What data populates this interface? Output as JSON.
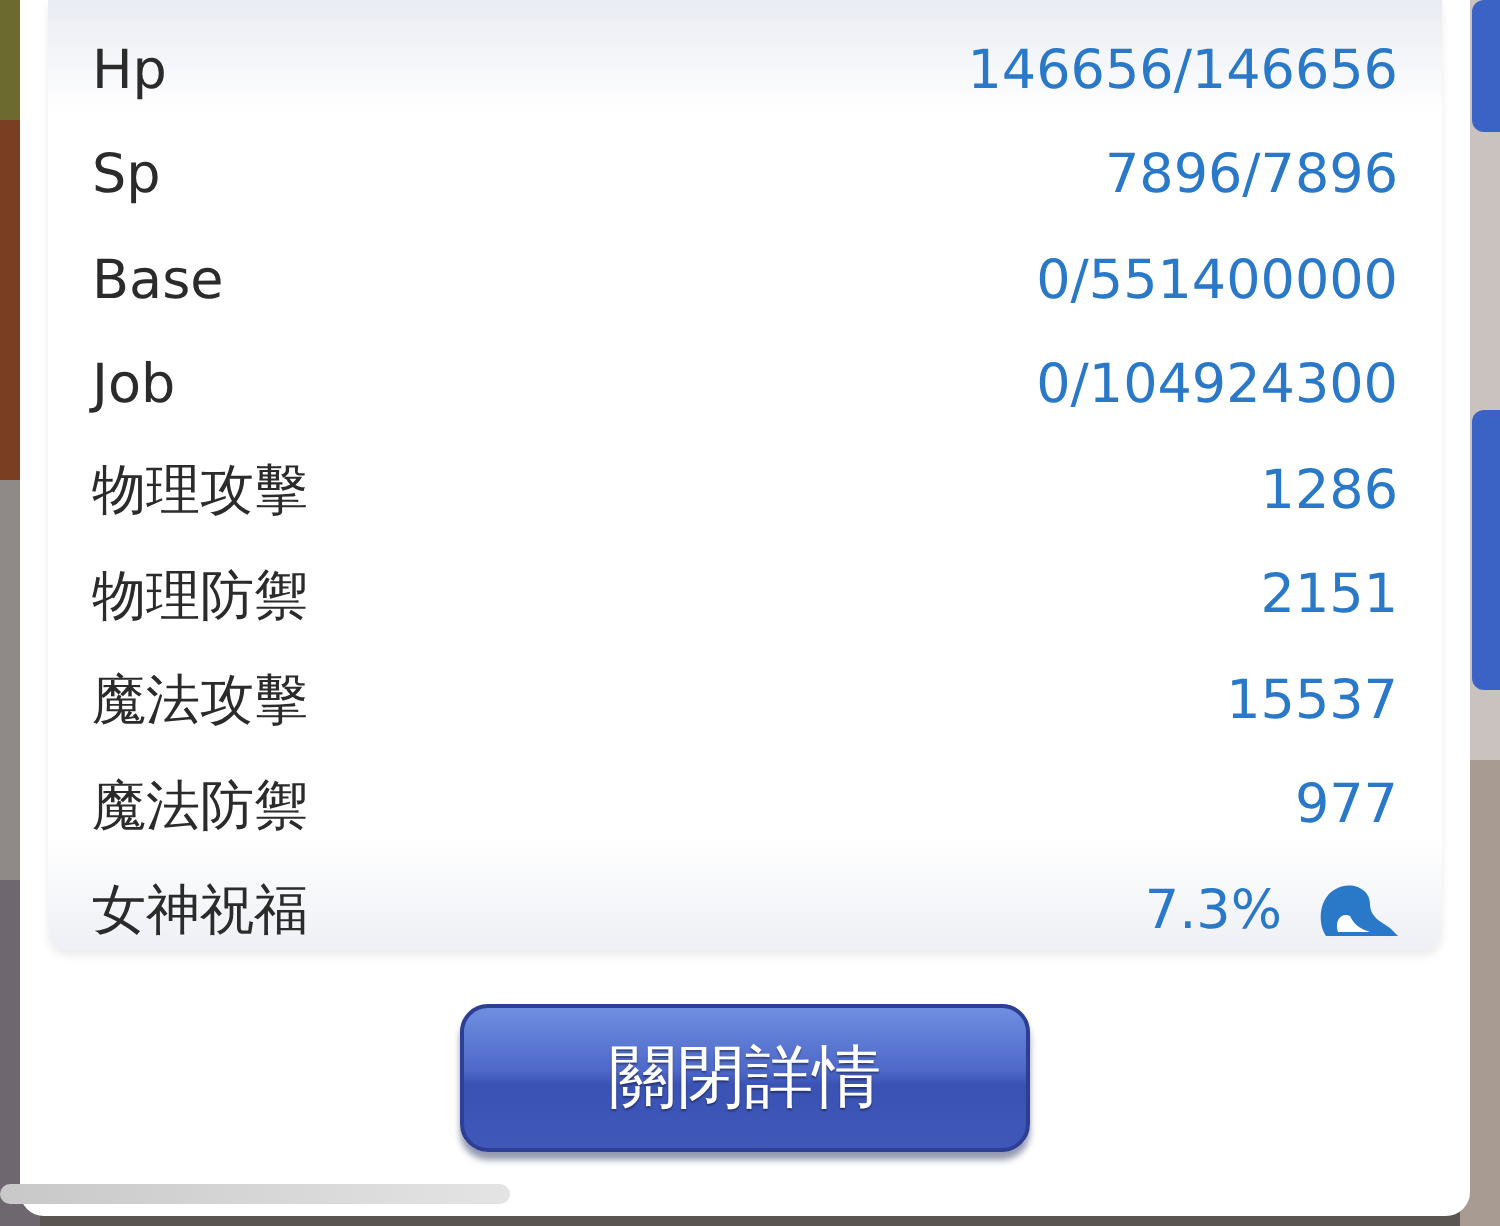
{
  "stats": [
    {
      "kind": "plain",
      "label": "Hp",
      "value": "146656/146656"
    },
    {
      "kind": "plain",
      "label": "Sp",
      "value": "7896/7896"
    },
    {
      "kind": "plain",
      "label": "Base",
      "value": "0/551400000"
    },
    {
      "kind": "plain",
      "label": "Job",
      "value": "0/104924300"
    },
    {
      "kind": "plain",
      "label": "物理攻擊",
      "value": "1286"
    },
    {
      "kind": "plain",
      "label": "物理防禦",
      "value": "2151"
    },
    {
      "kind": "plain",
      "label": "魔法攻擊",
      "value": "15537"
    },
    {
      "kind": "plain",
      "label": "魔法防禦",
      "value": "977"
    },
    {
      "kind": "with-icon",
      "label": "女神祝福",
      "value": "7.3%"
    }
  ],
  "close_button": {
    "label": "關閉詳情"
  }
}
